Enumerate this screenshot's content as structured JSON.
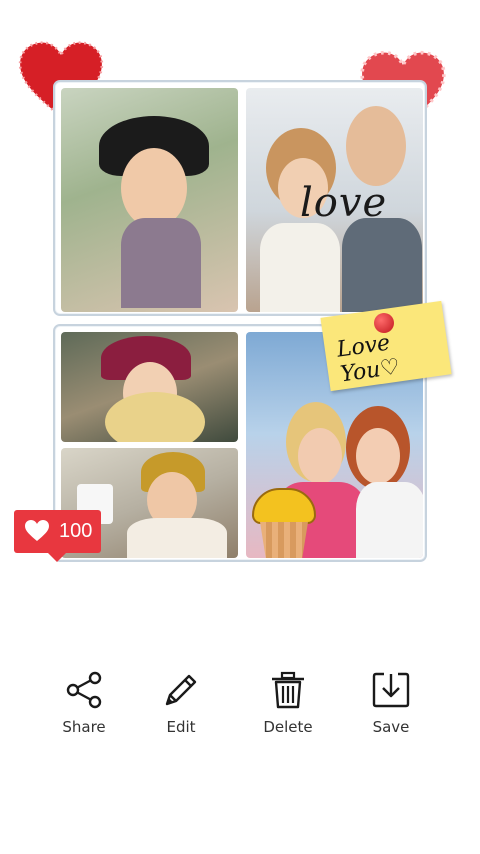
{
  "collage": {
    "photos": [
      {
        "name": "photo-woman-hat-glasses"
      },
      {
        "name": "photo-couple-selfie"
      },
      {
        "name": "photo-woman-red-hat"
      },
      {
        "name": "photo-woman-yellow-beanie"
      },
      {
        "name": "photo-two-women-kiss"
      }
    ],
    "love_text": "love",
    "sticky_note_text": "Love You♡"
  },
  "like_badge": {
    "count": "100",
    "accent": "#e8373f"
  },
  "actions": [
    {
      "label": "Share",
      "icon": "share-icon"
    },
    {
      "label": "Edit",
      "icon": "pencil-icon"
    },
    {
      "label": "Delete",
      "icon": "trash-icon"
    },
    {
      "label": "Save",
      "icon": "download-icon"
    }
  ],
  "colors": {
    "frame_border": "#c7d3de",
    "icon": "#1a1a1a",
    "label": "#333333"
  }
}
